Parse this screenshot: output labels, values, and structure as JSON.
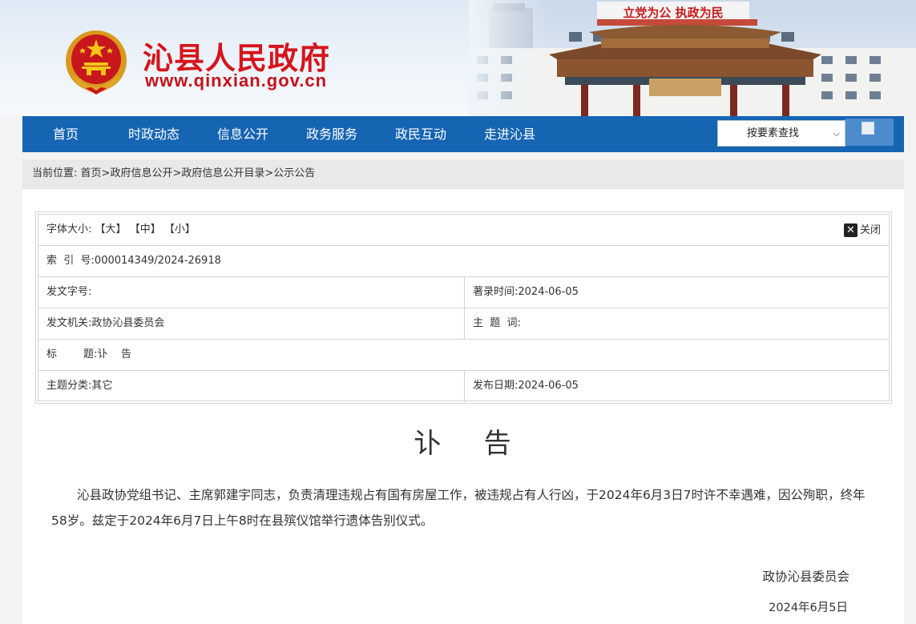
{
  "header": {
    "site_title": "沁县人民政府",
    "site_domain": "www.qinxian.gov.cn",
    "banner_sign": "立党为公 执政为民",
    "colors": {
      "brand_red": "#d6141c",
      "nav_blue": "#1665b3"
    }
  },
  "nav": {
    "items": [
      "首页",
      "时政动态",
      "信息公开",
      "政务服务",
      "政民互动",
      "走进沁县"
    ],
    "search_select": "按要素查找"
  },
  "breadcrumb": {
    "prefix": "当前位置:",
    "items": [
      "首页",
      "政府信息公开",
      "政府信息公开目录",
      "公示公告"
    ],
    "sep": ">"
  },
  "info": {
    "font_size_label": "字体大小:",
    "font_large": "【大】",
    "font_medium": "【中】",
    "font_small": "【小】",
    "close_label": "关闭",
    "index_label": "索  引  号:",
    "index_value": "000014349/2024-26918",
    "doc_no_label": "发文字号:",
    "doc_no_value": "",
    "record_time_label": "著录时间:",
    "record_time_value": "2024-06-05",
    "issuer_label": "发文机关:",
    "issuer_value": "政协沁县委员会",
    "subject_label": "主  题  词:",
    "subject_value": "",
    "title_label": "标        题:",
    "title_value": "讣    告",
    "category_label": "主题分类:",
    "category_value": "其它",
    "publish_date_label": "发布日期:",
    "publish_date_value": "2024-06-05"
  },
  "document": {
    "title": "讣    告",
    "body": "沁县政协党组书记、主席郭建宇同志，负责清理违规占有国有房屋工作，被违规占有人行凶，于2024年6月3日7时许不幸遇难，因公殉职，终年58岁。兹定于2024年6月7日上午8时在县殡仪馆举行遗体告别仪式。",
    "signature": "政协沁县委员会",
    "date": "2024年6月5日"
  }
}
